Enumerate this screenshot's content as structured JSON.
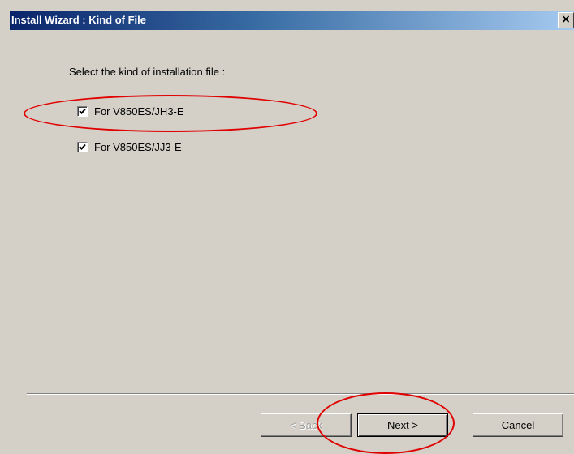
{
  "window": {
    "title": "Install Wizard : Kind of File",
    "close_symbol": "✕"
  },
  "main": {
    "prompt": "Select the kind of installation file :",
    "options": [
      {
        "label": "For V850ES/JH3-E",
        "checked": true
      },
      {
        "label": "For V850ES/JJ3-E",
        "checked": true
      }
    ]
  },
  "footer": {
    "back_label": "< Back",
    "next_label": "Next >",
    "cancel_label": "Cancel"
  },
  "colors": {
    "dialog_bg": "#d4d0c8",
    "title_start": "#0a246a",
    "title_end": "#a6caf0",
    "annotation": "#e00000"
  }
}
